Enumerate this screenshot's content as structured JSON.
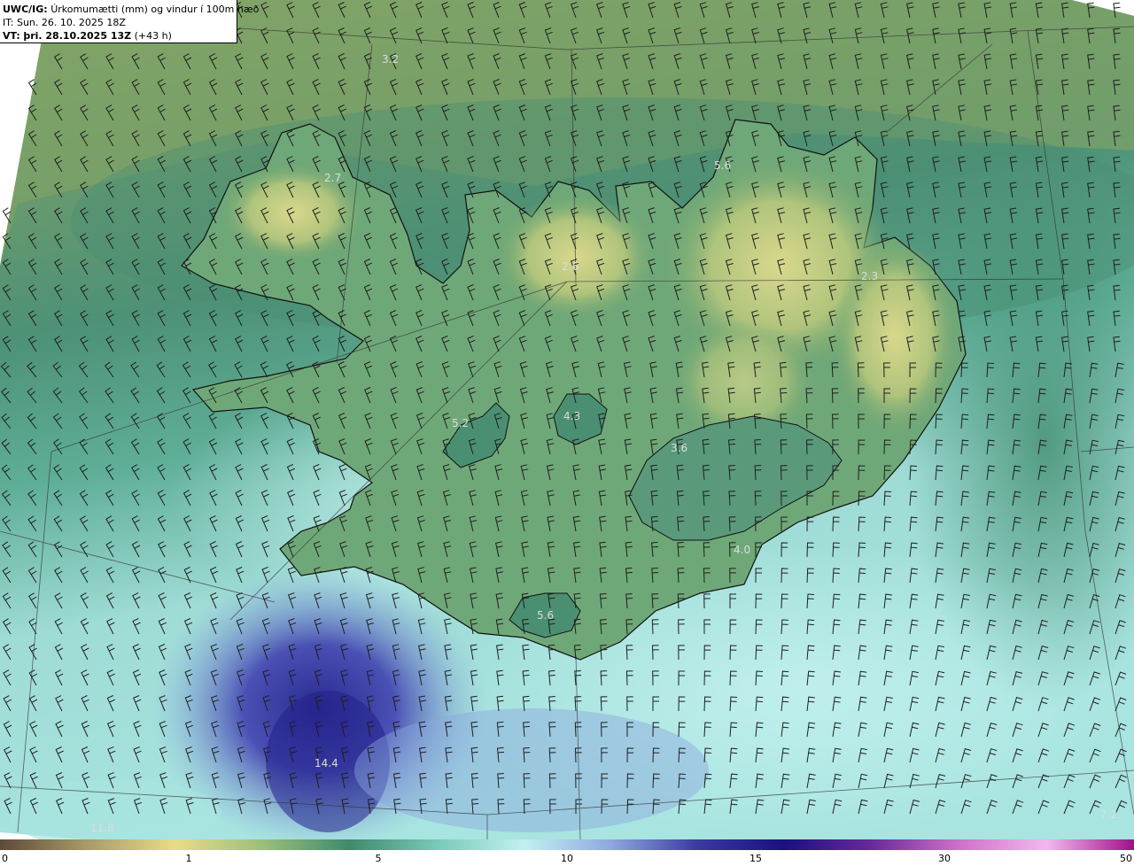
{
  "header": {
    "title_bold": "UWC/IG:",
    "title_rest": "Úrkomumætti (mm) og vindur í 100m hæð",
    "init_time": "IT: Sun. 26. 10. 2025 18Z",
    "valid_label": "VT:",
    "valid_time": "þri. 28.10.2025 13Z",
    "lead": "(+43 h)"
  },
  "map_labels": [
    {
      "id": "label-3-2",
      "text": "3.2"
    },
    {
      "id": "label-2-7",
      "text": "2.7"
    },
    {
      "id": "label-5-6-north",
      "text": "5.6"
    },
    {
      "id": "label-2-6",
      "text": "2.6"
    },
    {
      "id": "label-2-3",
      "text": "2.3"
    },
    {
      "id": "label-5-2",
      "text": "5.2"
    },
    {
      "id": "label-4-3",
      "text": "4.3"
    },
    {
      "id": "label-3-6",
      "text": "3.6"
    },
    {
      "id": "label-4-0",
      "text": "4.0"
    },
    {
      "id": "label-5-6-south",
      "text": "5.6"
    },
    {
      "id": "label-14-4",
      "text": "14.4"
    },
    {
      "id": "label-11-8",
      "text": "11.8"
    },
    {
      "id": "label-7-2",
      "text": "7.2"
    }
  ],
  "colorbar": {
    "ticks": [
      "0",
      "1",
      "5",
      "10",
      "15",
      "30",
      "50"
    ],
    "stops": [
      "#5e4a3a",
      "#a89a6a",
      "#e8dc88",
      "#9cbf7c",
      "#3f8a6c",
      "#78c9b8",
      "#c2f0f0",
      "#8fa9e0",
      "#3a3aa0",
      "#1a1080",
      "#6a2a9a",
      "#d070c8",
      "#f2b8ec",
      "#a0108a"
    ]
  },
  "map_colors": {
    "sea_north": "#8aa866",
    "sea_mid": "#4d9176",
    "sea_south_light": "#a8e4e0",
    "heavy_precip": "#4a4fb0",
    "land_high": "#cfd48a",
    "coastline": "#111111",
    "wind_barb": "#1e1e1e"
  }
}
